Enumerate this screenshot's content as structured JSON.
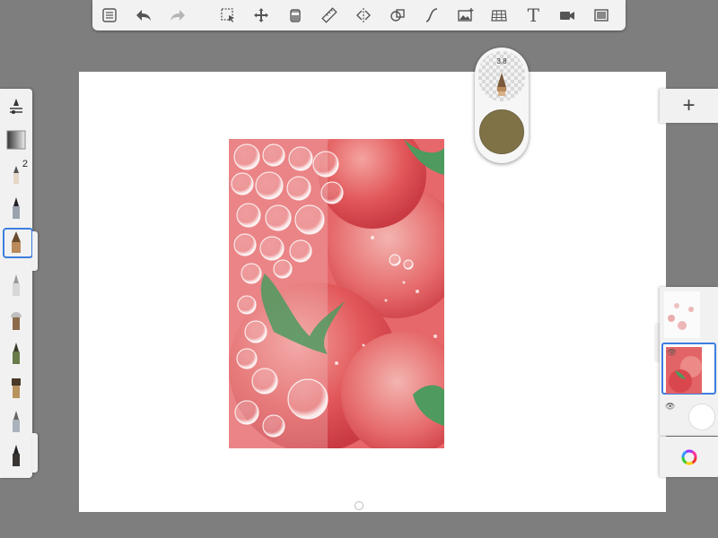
{
  "toolbar": {
    "items": [
      {
        "name": "gallery-icon"
      },
      {
        "name": "undo-icon"
      },
      {
        "name": "redo-icon"
      },
      {
        "name": "selection-icon"
      },
      {
        "name": "transform-icon"
      },
      {
        "name": "fill-icon"
      },
      {
        "name": "ruler-icon"
      },
      {
        "name": "symmetry-icon"
      },
      {
        "name": "shapes-icon"
      },
      {
        "name": "stroke-icon"
      },
      {
        "name": "import-image-icon"
      },
      {
        "name": "perspective-icon"
      },
      {
        "name": "text-icon",
        "label": "T"
      },
      {
        "name": "record-icon"
      },
      {
        "name": "fullscreen-icon"
      }
    ]
  },
  "brush_puck": {
    "size_label": "3.8",
    "color": "#807247"
  },
  "brush_palette": {
    "brushes": [
      {
        "name": "brush-properties-icon"
      },
      {
        "name": "gradient-brush-icon"
      },
      {
        "name": "pencil-brush-icon",
        "count": "2"
      },
      {
        "name": "ink-pen-brush-icon"
      },
      {
        "name": "marker-brush-icon",
        "selected": true
      },
      {
        "name": "airbrush-icon"
      },
      {
        "name": "paintbrush-icon"
      },
      {
        "name": "round-brush-icon"
      },
      {
        "name": "flat-brush-icon"
      },
      {
        "name": "smudge-brush-icon"
      },
      {
        "name": "eraser-brush-icon"
      }
    ]
  },
  "layers": {
    "add_label": "+",
    "items": [
      {
        "name": "layer-bubbles"
      },
      {
        "name": "layer-tomatoes",
        "selected": true
      },
      {
        "name": "layer-background"
      }
    ]
  },
  "colors": {
    "accent": "#3d7ee0",
    "canvas": "#ffffff",
    "workspace": "#7e7e7e"
  }
}
